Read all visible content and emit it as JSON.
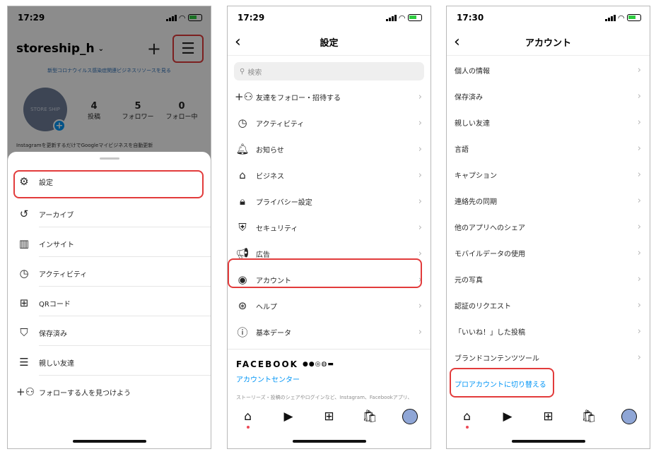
{
  "status": {
    "p1_time": "17:29",
    "p2_time": "17:29",
    "p3_time": "17:30"
  },
  "profile": {
    "username": "storeship_h",
    "banner": "新型コロナウイルス感染症関連ビジネスリソースを見る",
    "avatar_text": "STORE SHIP",
    "stats": [
      {
        "n": "4",
        "label": "投稿"
      },
      {
        "n": "5",
        "label": "フォロワー"
      },
      {
        "n": "0",
        "label": "フォロー中"
      }
    ],
    "bio": "Instagramを更新するだけでGoogleマイビジネスを自動更新"
  },
  "menu_items": [
    {
      "label": "設定",
      "icon": "gear-icon"
    },
    {
      "label": "アーカイブ",
      "icon": "archive-icon"
    },
    {
      "label": "インサイト",
      "icon": "insights-icon"
    },
    {
      "label": "アクティビティ",
      "icon": "activity-icon"
    },
    {
      "label": "QRコード",
      "icon": "qr-icon"
    },
    {
      "label": "保存済み",
      "icon": "bookmark-icon"
    },
    {
      "label": "親しい友達",
      "icon": "close-friends-icon"
    },
    {
      "label": "フォローする人を見つけよう",
      "icon": "add-person-icon"
    }
  ],
  "settings": {
    "title": "設定",
    "search_placeholder": "検索",
    "items": [
      {
        "label": "友達をフォロー・招待する",
        "icon": "add-person-icon"
      },
      {
        "label": "アクティビティ",
        "icon": "activity-icon"
      },
      {
        "label": "お知らせ",
        "icon": "bell-icon"
      },
      {
        "label": "ビジネス",
        "icon": "store-icon"
      },
      {
        "label": "プライバシー設定",
        "icon": "lock-icon"
      },
      {
        "label": "セキュリティ",
        "icon": "shield-icon"
      },
      {
        "label": "広告",
        "icon": "megaphone-icon"
      },
      {
        "label": "アカウント",
        "icon": "account-icon"
      },
      {
        "label": "ヘルプ",
        "icon": "lifebuoy-icon"
      },
      {
        "label": "基本データ",
        "icon": "info-icon"
      }
    ],
    "facebook_word": "FACEBOOK",
    "accounts_center": "アカウントセンター",
    "fb_note": "ストーリーズ・投稿のシェアやログインなど、Instagram、Facebookアプリ、"
  },
  "account": {
    "title": "アカウント",
    "items": [
      "個人の情報",
      "保存済み",
      "親しい友達",
      "言語",
      "キャプション",
      "連絡先の同期",
      "他のアプリへのシェア",
      "モバイルデータの使用",
      "元の写真",
      "認証のリクエスト",
      "「いいね！」した投稿",
      "ブランドコンテンツツール"
    ],
    "switch_pro": "プロアカウントに切り替える"
  },
  "colors": {
    "highlight": "#e23b3b",
    "link": "#0095f6"
  }
}
